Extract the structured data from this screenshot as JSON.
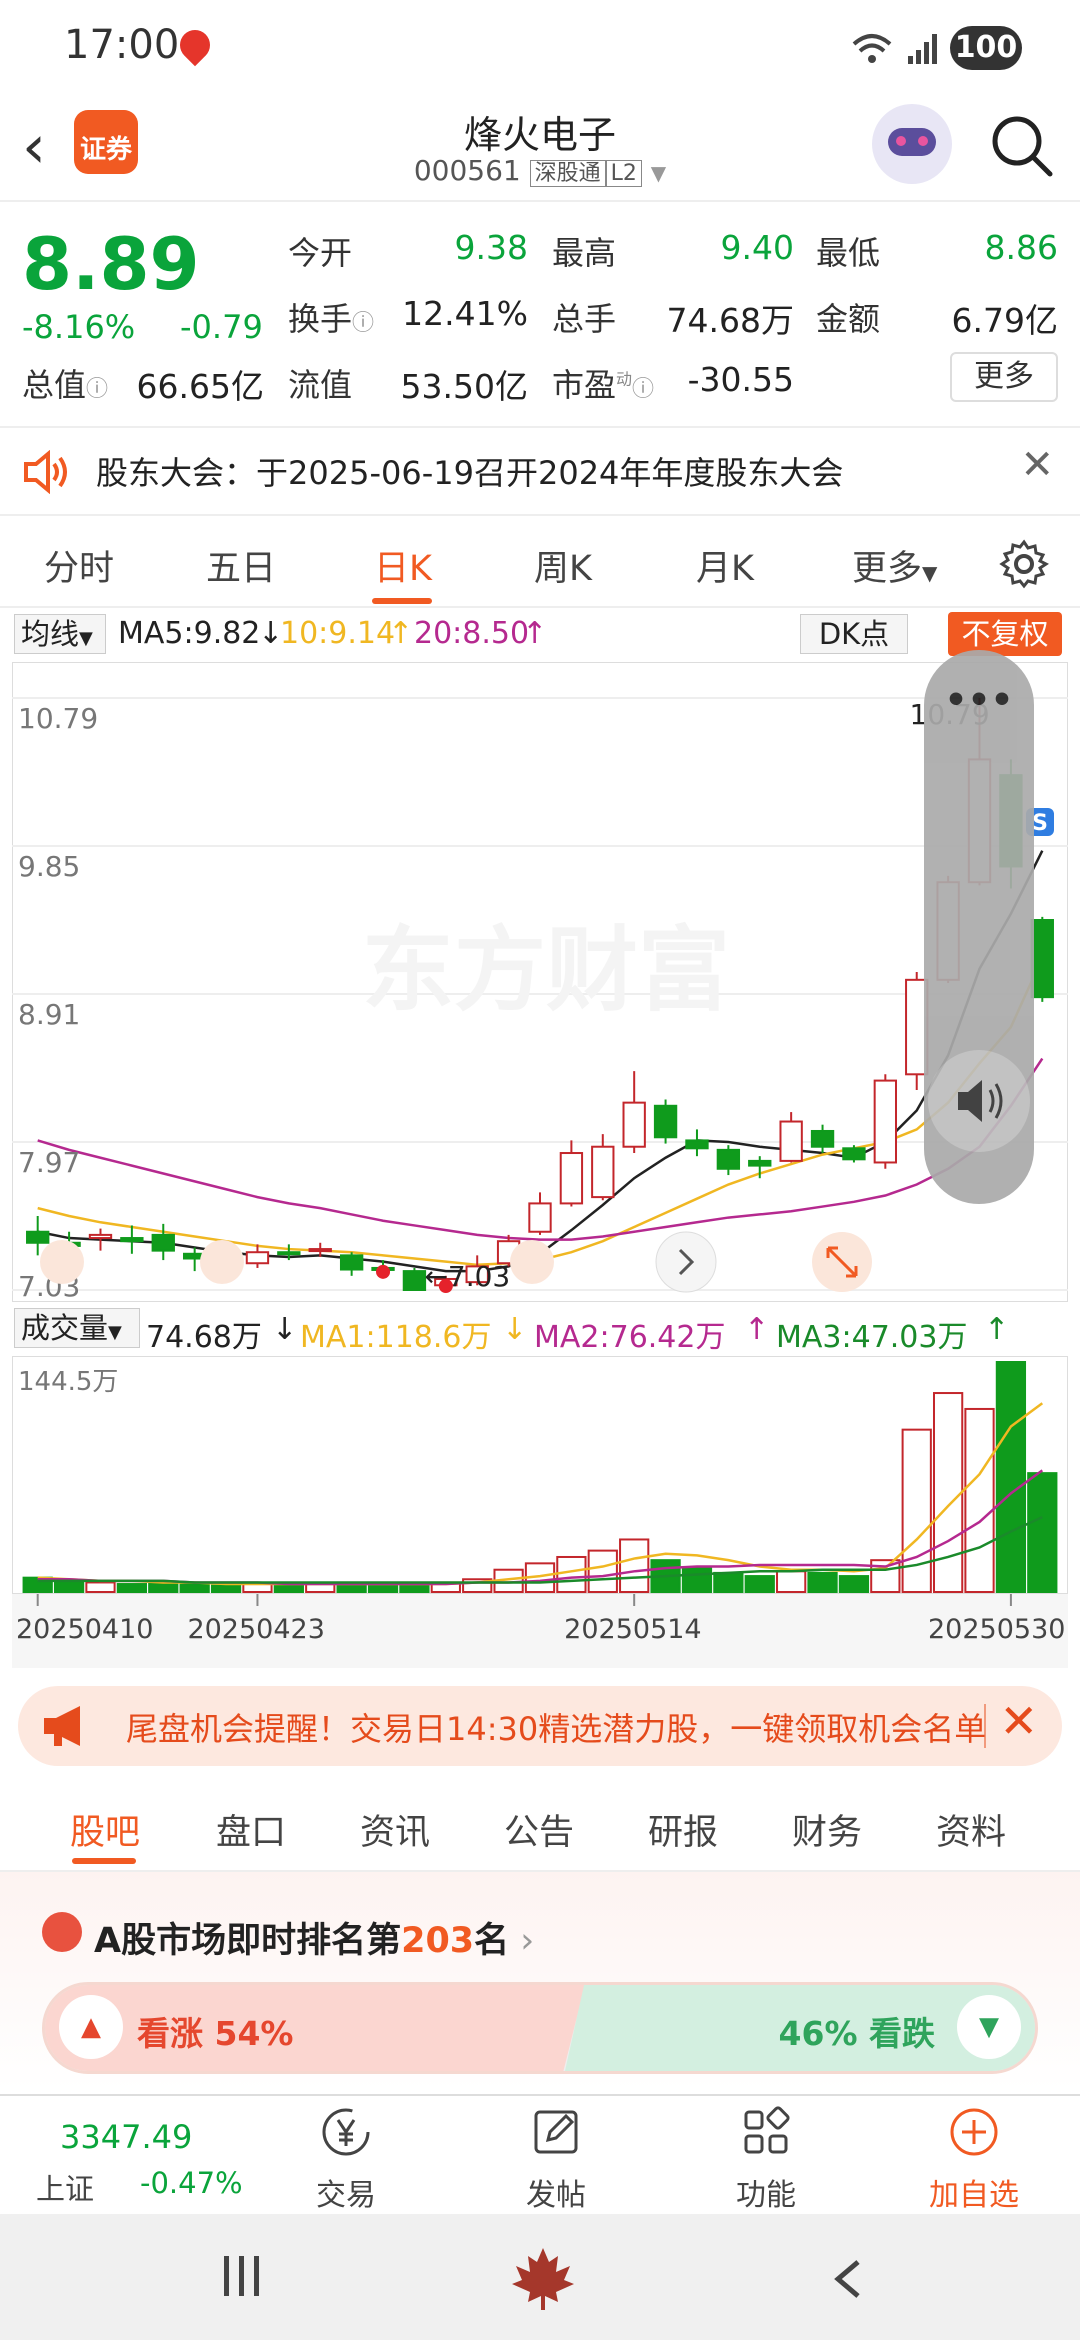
{
  "status_bar": {
    "time": "17:00",
    "battery": "100"
  },
  "header": {
    "logo_text": "证券",
    "stock_name": "烽火电子",
    "stock_code": "000561",
    "connect_tag": "深股通",
    "level_tag": "L2"
  },
  "quote": {
    "price": "8.89",
    "change_pct": "-8.16%",
    "change": "-0.79",
    "fields": [
      {
        "label": "今开",
        "value": "9.38",
        "color": "#0aa43b"
      },
      {
        "label": "最高",
        "value": "9.40",
        "color": "#0aa43b"
      },
      {
        "label": "最低",
        "value": "8.86",
        "color": "#0aa43b"
      },
      {
        "label": "换手",
        "value": "12.41%",
        "color": "#222222"
      },
      {
        "label": "总手",
        "value": "74.68万",
        "color": "#222222"
      },
      {
        "label": "金额",
        "value": "6.79亿",
        "color": "#222222"
      },
      {
        "label": "总值",
        "value": "66.65亿",
        "color": "#222222"
      },
      {
        "label": "流值",
        "value": "53.50亿",
        "color": "#222222"
      },
      {
        "label": "市盈",
        "value": "-30.55",
        "color": "#222222"
      }
    ],
    "pe_sup": "动",
    "more_label": "更多"
  },
  "notice": {
    "text": "股东大会：于2025-06-19召开2024年年度股东大会"
  },
  "chart_tabs": [
    "分时",
    "五日",
    "日K",
    "周K",
    "月K",
    "更多"
  ],
  "chart_active_tab": "日K",
  "ma_bar": {
    "selector": "均线",
    "ma5": "MA5:9.82",
    "ma10": "10:9.14",
    "ma20": "20:8.50",
    "dk_label": "DK点",
    "fq_label": "不复权"
  },
  "watermark": "东方财富",
  "chart_data": [
    {
      "type": "candlestick",
      "title": "",
      "y_ticks": [
        "10.79",
        "9.85",
        "8.91",
        "7.97",
        "7.03"
      ],
      "ylim": [
        7.03,
        10.79
      ],
      "high_label": "10.79",
      "low_label": "7.03",
      "x_ticks": [
        "20250410",
        "20250423",
        "20250514",
        "20250530"
      ],
      "candles": [
        {
          "o": 7.4,
          "c": 7.33,
          "h": 7.5,
          "l": 7.25
        },
        {
          "o": 7.33,
          "c": 7.31,
          "h": 7.4,
          "l": 7.2
        },
        {
          "o": 7.36,
          "c": 7.38,
          "h": 7.42,
          "l": 7.28
        },
        {
          "o": 7.36,
          "c": 7.34,
          "h": 7.44,
          "l": 7.26
        },
        {
          "o": 7.38,
          "c": 7.28,
          "h": 7.45,
          "l": 7.22
        },
        {
          "o": 7.26,
          "c": 7.23,
          "h": 7.3,
          "l": 7.15
        },
        {
          "o": 7.2,
          "c": 7.18,
          "h": 7.26,
          "l": 7.12
        },
        {
          "o": 7.2,
          "c": 7.27,
          "h": 7.32,
          "l": 7.17
        },
        {
          "o": 7.27,
          "c": 7.26,
          "h": 7.32,
          "l": 7.22
        },
        {
          "o": 7.28,
          "c": 7.29,
          "h": 7.33,
          "l": 7.24
        },
        {
          "o": 7.25,
          "c": 7.16,
          "h": 7.27,
          "l": 7.12
        },
        {
          "o": 7.17,
          "c": 7.16,
          "h": 7.22,
          "l": 7.12
        },
        {
          "o": 7.15,
          "c": 7.03,
          "h": 7.17,
          "l": 7.03
        },
        {
          "o": 7.06,
          "c": 7.1,
          "h": 7.12,
          "l": 7.03
        },
        {
          "o": 7.08,
          "c": 7.18,
          "h": 7.25,
          "l": 7.06
        },
        {
          "o": 7.2,
          "c": 7.34,
          "h": 7.38,
          "l": 7.18
        },
        {
          "o": 7.4,
          "c": 7.58,
          "h": 7.65,
          "l": 7.38
        },
        {
          "o": 7.58,
          "c": 7.9,
          "h": 7.98,
          "l": 7.56
        },
        {
          "o": 7.62,
          "c": 7.94,
          "h": 8.02,
          "l": 7.6
        },
        {
          "o": 7.94,
          "c": 8.22,
          "h": 8.42,
          "l": 7.9
        },
        {
          "o": 8.2,
          "c": 8.0,
          "h": 8.24,
          "l": 7.96
        },
        {
          "o": 7.98,
          "c": 7.93,
          "h": 8.05,
          "l": 7.88
        },
        {
          "o": 7.92,
          "c": 7.8,
          "h": 7.95,
          "l": 7.76
        },
        {
          "o": 7.85,
          "c": 7.82,
          "h": 7.88,
          "l": 7.74
        },
        {
          "o": 7.85,
          "c": 8.1,
          "h": 8.16,
          "l": 7.84
        },
        {
          "o": 8.04,
          "c": 7.94,
          "h": 8.08,
          "l": 7.9
        },
        {
          "o": 7.93,
          "c": 7.86,
          "h": 7.95,
          "l": 7.84
        },
        {
          "o": 7.84,
          "c": 8.36,
          "h": 8.4,
          "l": 7.8
        },
        {
          "o": 8.4,
          "c": 9.0,
          "h": 9.05,
          "l": 8.3
        },
        {
          "o": 9.0,
          "c": 9.62,
          "h": 9.66,
          "l": 8.98
        },
        {
          "o": 9.62,
          "c": 10.4,
          "h": 10.79,
          "l": 9.6
        },
        {
          "o": 10.3,
          "c": 9.72,
          "h": 10.4,
          "l": 9.58
        },
        {
          "o": 9.38,
          "c": 8.89,
          "h": 9.4,
          "l": 8.86
        }
      ],
      "series": [
        {
          "name": "MA5",
          "color": "#222222",
          "values": [
            7.4,
            7.36,
            7.35,
            7.34,
            7.33,
            7.3,
            7.27,
            7.25,
            7.24,
            7.25,
            7.23,
            7.21,
            7.18,
            7.15,
            7.15,
            7.18,
            7.26,
            7.41,
            7.57,
            7.74,
            7.87,
            7.98,
            7.97,
            7.94,
            7.92,
            7.9,
            7.87,
            7.97,
            8.17,
            8.52,
            9.07,
            9.42,
            9.82
          ]
        },
        {
          "name": "MA10",
          "color": "#f0b722",
          "values": [
            7.55,
            7.5,
            7.46,
            7.43,
            7.4,
            7.37,
            7.34,
            7.31,
            7.29,
            7.28,
            7.27,
            7.25,
            7.23,
            7.21,
            7.19,
            7.2,
            7.22,
            7.27,
            7.34,
            7.43,
            7.52,
            7.61,
            7.7,
            7.77,
            7.83,
            7.89,
            7.93,
            7.97,
            8.05,
            8.22,
            8.47,
            8.7,
            9.14
          ]
        },
        {
          "name": "MA20",
          "color": "#b5298f",
          "values": [
            7.98,
            7.92,
            7.87,
            7.82,
            7.77,
            7.72,
            7.67,
            7.62,
            7.58,
            7.55,
            7.51,
            7.47,
            7.44,
            7.41,
            7.38,
            7.36,
            7.35,
            7.35,
            7.37,
            7.4,
            7.43,
            7.46,
            7.49,
            7.51,
            7.53,
            7.56,
            7.59,
            7.63,
            7.7,
            7.8,
            7.94,
            8.2,
            8.5
          ]
        }
      ]
    },
    {
      "type": "bar",
      "title": "",
      "selector": "成交量",
      "value_label": "74.68万",
      "ma1": "MA1:118.6万",
      "ma2": "MA2:76.42万",
      "ma3": "MA3:47.03万",
      "ymax_label": "144.5万",
      "ylim": [
        0,
        144.5
      ],
      "values": [
        9,
        7,
        6,
        5,
        6,
        5,
        4,
        5,
        5,
        5,
        5,
        5,
        5,
        6,
        8,
        14,
        18,
        22,
        26,
        33,
        20,
        15,
        12,
        10,
        13,
        12,
        10,
        20,
        102,
        125,
        115,
        144.5,
        74.68
      ],
      "series": [
        {
          "name": "MA1",
          "color": "#f0b722",
          "values": [
            9,
            8,
            7,
            7,
            6,
            6,
            5,
            5,
            5,
            5,
            5,
            5,
            5,
            5,
            6,
            8,
            10,
            13,
            16,
            21,
            24,
            23,
            20,
            16,
            14,
            14,
            13,
            15,
            33,
            54,
            74,
            104,
            118.6
          ]
        },
        {
          "name": "MA2",
          "color": "#b5298f",
          "values": [
            8,
            8,
            7,
            7,
            7,
            6,
            6,
            6,
            5,
            5,
            5,
            5,
            5,
            5,
            6,
            6,
            7,
            9,
            10,
            13,
            15,
            16,
            16,
            17,
            17,
            17,
            17,
            16,
            22,
            32,
            44,
            62,
            76.42
          ]
        },
        {
          "name": "MA3",
          "color": "#1a8a2a",
          "values": [
            7,
            7,
            7,
            7,
            7,
            6,
            6,
            6,
            6,
            6,
            6,
            6,
            6,
            6,
            6,
            6,
            6,
            7,
            8,
            9,
            10,
            11,
            12,
            13,
            13,
            14,
            14,
            14,
            17,
            22,
            28,
            38,
            47.03
          ]
        }
      ]
    }
  ],
  "promo": {
    "text": "尾盘机会提醒！交易日14:30精选潜力股，一键领取机会名单"
  },
  "guba_tabs": [
    "股吧",
    "盘口",
    "资讯",
    "公告",
    "研报",
    "财务",
    "资料"
  ],
  "rank": {
    "prefix": "A股市场即时排名第",
    "number": "203",
    "suffix": "名"
  },
  "sentiment": {
    "bull_label": "看涨 54%",
    "bear_label": "46% 看跌",
    "bull_pct": 54
  },
  "bottom_bar": {
    "index_value": "3347.49",
    "index_name": "上证",
    "index_change": "-0.47%",
    "items": [
      "交易",
      "发帖",
      "功能",
      "加自选"
    ]
  }
}
